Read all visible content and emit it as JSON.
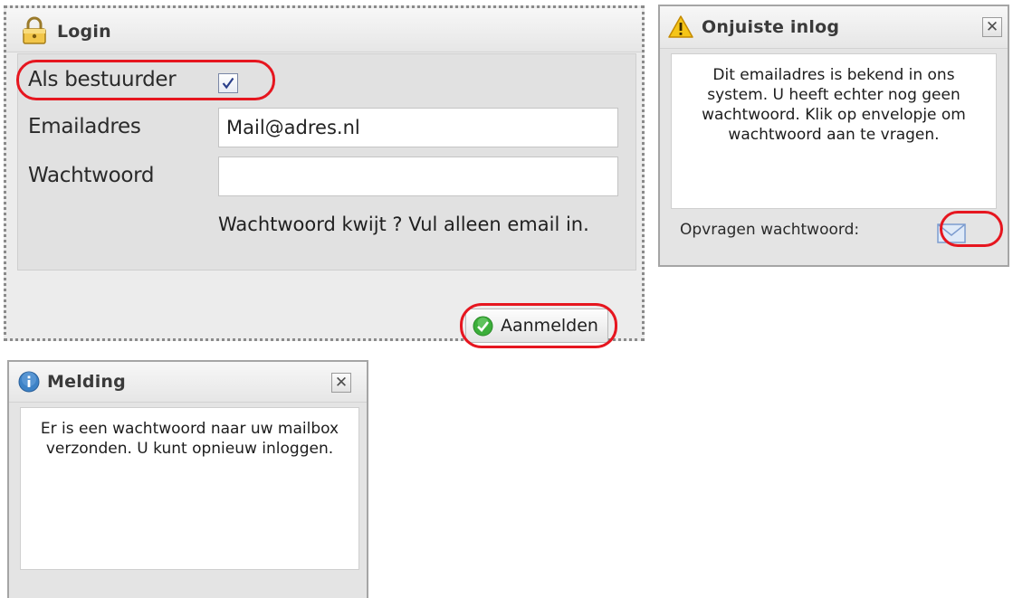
{
  "login": {
    "title": "Login",
    "driver_label": "Als bestuurder",
    "driver_checked": true,
    "email_label": "Emailadres",
    "email_value": "Mail@adres.nl",
    "password_label": "Wachtwoord",
    "password_value": "",
    "hint": "Wachtwoord kwijt ? Vul alleen email in.",
    "submit_label": "Aanmelden",
    "icons": {
      "title": "lock-icon",
      "submit": "checkmark-icon"
    }
  },
  "wrong_login": {
    "title": "Onjuiste inlog",
    "close_label": "✕",
    "message": "Dit emailadres is bekend in ons system. U heeft echter nog geen wachtwoord. Klik op envelopje om wachtwoord aan te vragen.",
    "request_label": "Opvragen wachtwoord:",
    "icons": {
      "title": "warning-icon",
      "request": "envelope-icon"
    }
  },
  "notice": {
    "title": "Melding",
    "close_label": "✕",
    "message": "Er is een wachtwoord naar uw mailbox verzonden. U kunt opnieuw inloggen.",
    "icons": {
      "title": "info-icon"
    }
  },
  "colors": {
    "highlight": "#e6161f",
    "checkmark_green": "#3cae3a",
    "info_blue": "#3d82c6",
    "warning_yellow": "#f5c518"
  }
}
